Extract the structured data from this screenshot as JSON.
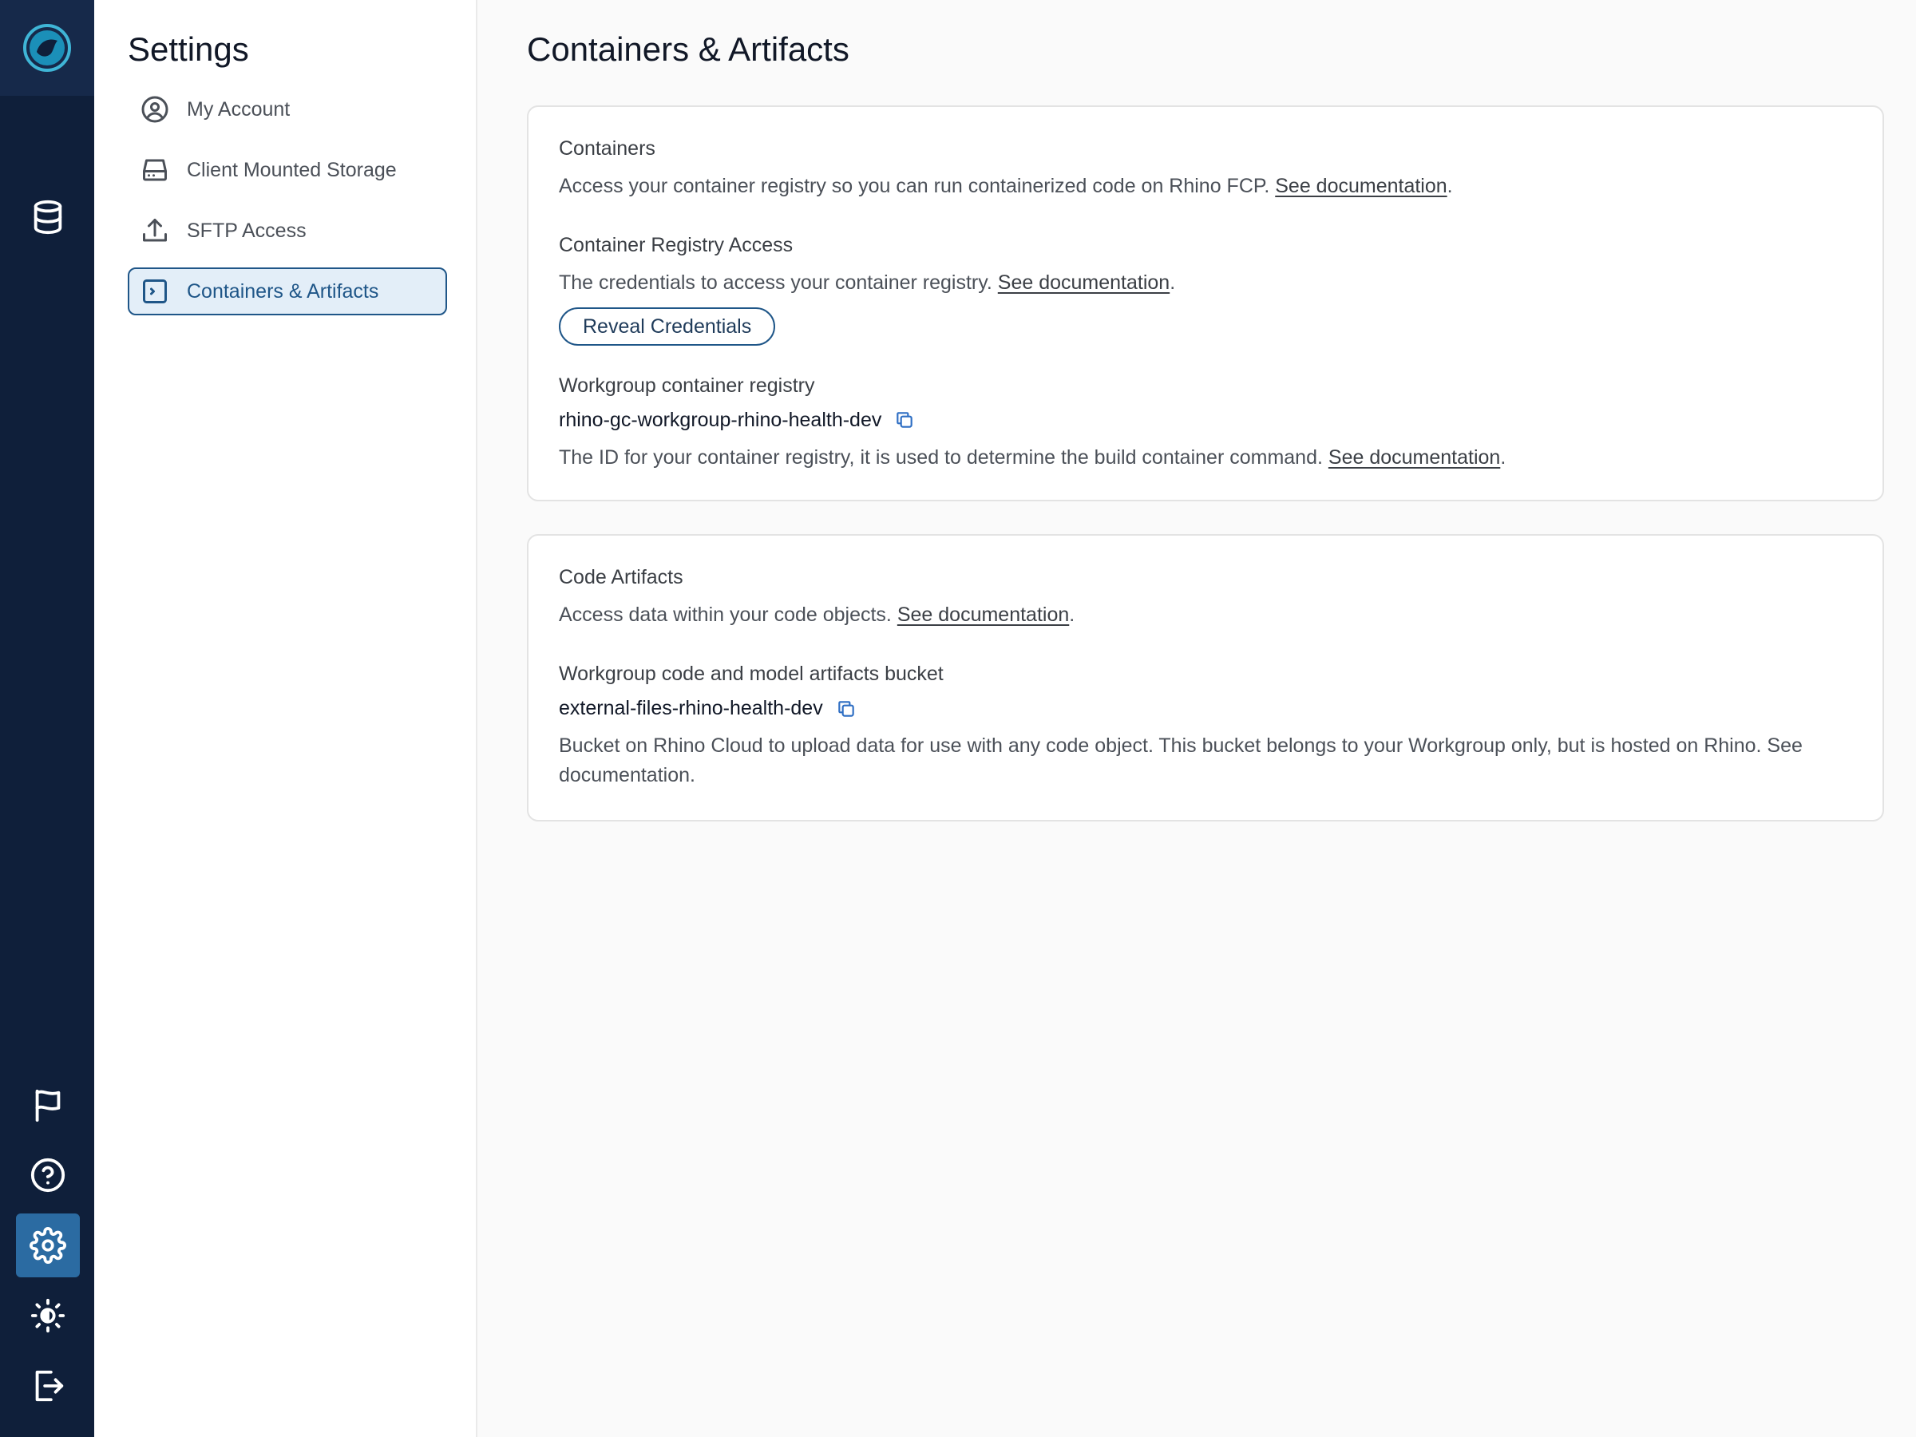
{
  "rail": {
    "icons": [
      "logo-icon",
      "database-icon",
      "flag-icon",
      "help-icon",
      "settings-icon",
      "brightness-icon",
      "logout-icon"
    ],
    "active": "settings-icon",
    "accent": "#2b6ba2",
    "background": "#0f1f3a"
  },
  "settings": {
    "title": "Settings",
    "items": [
      {
        "label": "My Account",
        "icon": "user-circle-icon"
      },
      {
        "label": "Client Mounted Storage",
        "icon": "hard-drive-icon"
      },
      {
        "label": "SFTP Access",
        "icon": "upload-icon"
      },
      {
        "label": "Containers & Artifacts",
        "icon": "terminal-icon",
        "active": true
      }
    ]
  },
  "main": {
    "title": "Containers & Artifacts",
    "containers": {
      "title": "Containers",
      "desc": "Access your container registry so you can run containerized code on Rhino FCP. ",
      "link": "See documentation",
      "suffix": "."
    },
    "registry_access": {
      "title": "Container Registry Access",
      "desc": "The credentials to access your container registry. ",
      "link": "See documentation",
      "suffix": ".",
      "button": "Reveal Credentials"
    },
    "workgroup_registry": {
      "title": "Workgroup container registry",
      "value": "rhino-gc-workgroup-rhino-health-dev",
      "desc": "The ID for your container registry, it is used to determine the build container command. ",
      "link": "See documentation",
      "suffix": "."
    },
    "code_artifacts": {
      "title": "Code Artifacts",
      "desc": "Access data within your code objects. ",
      "link": "See documentation",
      "suffix": "."
    },
    "artifacts_bucket": {
      "title": "Workgroup code and model artifacts bucket",
      "value": "external-files-rhino-health-dev",
      "desc": "Bucket on Rhino Cloud to upload data for use with any code object. This bucket belongs to your Workgroup only, but is hosted on Rhino.  See documentation."
    }
  }
}
